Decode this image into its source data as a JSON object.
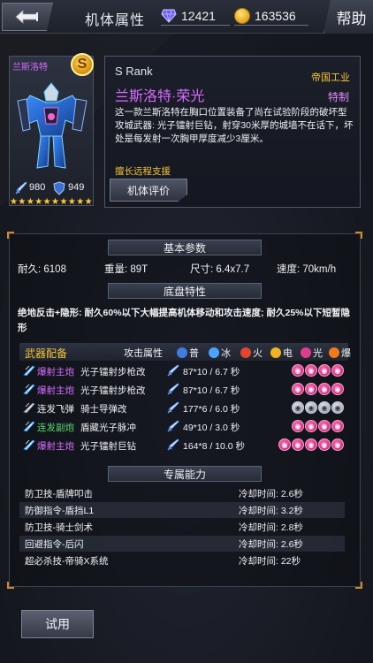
{
  "header": {
    "title": "机体属性",
    "gems": "12421",
    "coins": "163536",
    "help_label": "帮助"
  },
  "mech": {
    "name_tag": "兰斯洛特",
    "rank_letter": "S",
    "attack_stat": "980",
    "defense_stat": "949",
    "stars": 10
  },
  "description": {
    "rank": "S Rank",
    "title": "兰斯洛特·荣光",
    "maker": "帝国工业",
    "special": "特制",
    "text": "这一款兰斯洛特在胸口位置装备了尚在试验阶段的破坏型攻城武器: 光子镭射巨钻，射穿30米厚的城墙不在话下，坏处是每发射一次胸甲厚度减少3厘米。",
    "skill_tag": "擅长远程支援",
    "eval_button": "机体评价"
  },
  "basic": {
    "header": "基本参数",
    "durability": "耐久: 6108",
    "weight": "重量: 89T",
    "size": "尺寸: 6.4x7.7",
    "speed": "速度: 70km/h"
  },
  "chassis": {
    "header": "底盘特性",
    "text": "绝地反击+隐形: 耐久60%以下大幅提高机体移动和攻击速度; 耐久25%以下短暂隐形"
  },
  "weapons": {
    "header": "武器配备",
    "attr_label": "攻击属性",
    "elements": [
      {
        "name": "普",
        "color": "#3f7de0"
      },
      {
        "name": "冰",
        "color": "#4aa3ff"
      },
      {
        "name": "火",
        "color": "#e5452a"
      },
      {
        "name": "电",
        "color": "#f0b420"
      },
      {
        "name": "光",
        "color": "#e03c8c"
      },
      {
        "name": "爆",
        "color": "#f07a1c"
      }
    ],
    "rows": [
      {
        "type": "爆射主炮",
        "type_color": "#d86cff",
        "name": "光子镭射步枪改",
        "damage": "87*10 / 6.7 秒",
        "ammo_color": "pink",
        "ammo_count": 4
      },
      {
        "type": "爆射主炮",
        "type_color": "#d86cff",
        "name": "光子镭射步枪改",
        "damage": "87*10 / 6.7 秒",
        "ammo_color": "pink",
        "ammo_count": 4
      },
      {
        "type": "连发飞弹",
        "type_color": "#f0f2f6",
        "name": "骑士导弹改",
        "damage": "177*6 / 6.0 秒",
        "ammo_color": "gray",
        "ammo_count": 4
      },
      {
        "type": "连发副炮",
        "type_color": "#58d86c",
        "name": "盾藏光子脉冲",
        "damage": "49*10 / 3.0 秒",
        "ammo_color": "pink",
        "ammo_count": 4
      },
      {
        "type": "爆射主炮",
        "type_color": "#d86cff",
        "name": "光子镭射巨钻",
        "damage": "164*8 / 10.0 秒",
        "ammo_color": "pink",
        "ammo_count": 5
      }
    ]
  },
  "abilities": {
    "header": "专属能力",
    "rows": [
      {
        "name": "防卫技-盾牌叩击",
        "cooldown": "冷却时间: 2.6秒"
      },
      {
        "name": "防御指令-盾挡L1",
        "cooldown": "冷却时间: 3.2秒"
      },
      {
        "name": "防卫技-骑士剑术",
        "cooldown": "冷却时间: 2.8秒"
      },
      {
        "name": "回避指令-后闪",
        "cooldown": "冷却时间: 2.6秒"
      },
      {
        "name": "超必杀技-帝骑X系统",
        "cooldown": "冷却时间: 22秒"
      }
    ]
  },
  "footer": {
    "try_button": "试用"
  }
}
